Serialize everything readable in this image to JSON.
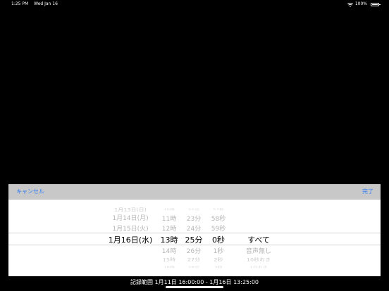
{
  "status_bar": {
    "time": "1:25 PM",
    "date": "Wed Jan 16",
    "battery": "100%"
  },
  "toolbar": {
    "cancel_label": "キャンセル",
    "done_label": "完了"
  },
  "picker": {
    "date_column": [
      "1月13日(日)",
      "1月14日(月)",
      "1月15日(火)",
      "1月16日(水)"
    ],
    "hour_column": [
      "10時",
      "11時",
      "12時",
      "13時",
      "14時",
      "15時",
      "16時"
    ],
    "minute_column": [
      "22分",
      "23分",
      "24分",
      "25分",
      "26分",
      "27分",
      "28分"
    ],
    "second_column": [
      "57秒",
      "58秒",
      "59秒",
      "0秒",
      "1秒",
      "2秒",
      "3秒"
    ],
    "filter_column": [
      "すべて",
      "音声無し",
      "10秒おき",
      "1分おき"
    ]
  },
  "footer": {
    "range_label": "記録範囲 1月11日 16:00:00 - 1月16日 13:25:00"
  },
  "colors": {
    "accent": "#2f7cf6",
    "toolbar_bg": "#c8c8c8"
  }
}
